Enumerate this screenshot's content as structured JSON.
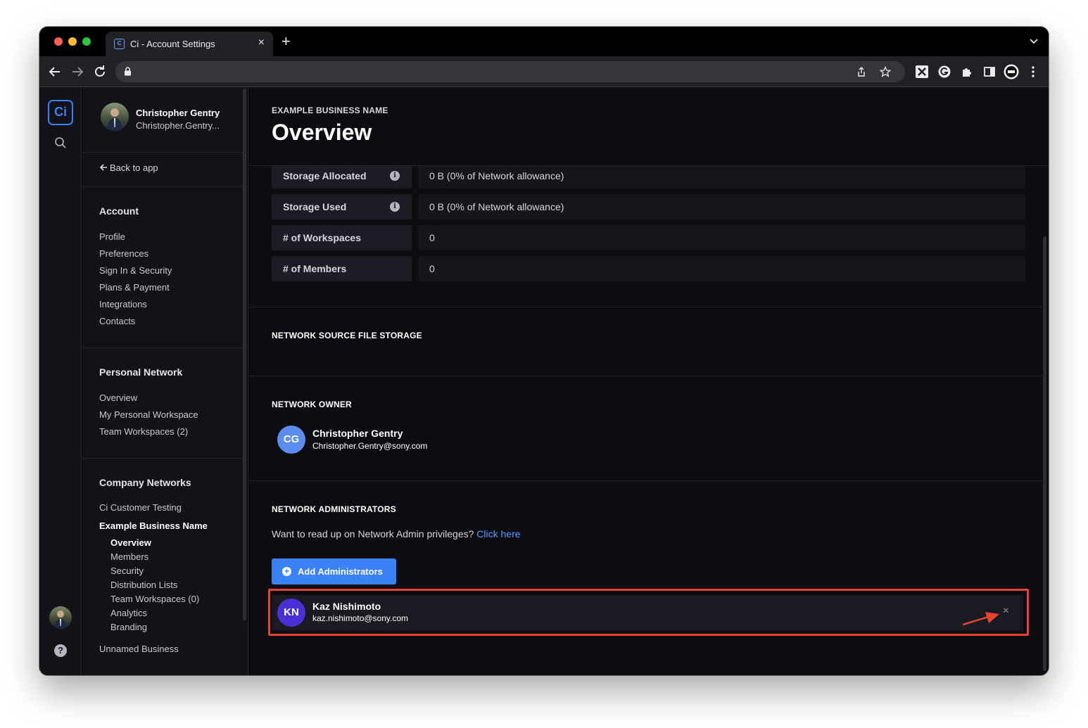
{
  "browser": {
    "tab_title": "Ci - Account Settings",
    "tab_close": "×",
    "new_tab": "+"
  },
  "rail": {
    "logo": "Ci"
  },
  "user": {
    "name": "Christopher Gentry",
    "email": "Christopher.Gentry..."
  },
  "sidebar": {
    "back_label": "Back to app",
    "account_heading": "Account",
    "account_items": [
      "Profile",
      "Preferences",
      "Sign In & Security",
      "Plans & Payment",
      "Integrations",
      "Contacts"
    ],
    "personal_heading": "Personal Network",
    "personal_items": [
      "Overview",
      "My Personal Workspace",
      "Team Workspaces (2)"
    ],
    "company_heading": "Company Networks",
    "company_items": [
      "Ci Customer Testing",
      "Example Business Name"
    ],
    "company_sub_items": [
      "Overview",
      "Members",
      "Security",
      "Distribution Lists",
      "Team Workspaces (0)",
      "Analytics",
      "Branding"
    ],
    "other_network": "Unnamed Business"
  },
  "header": {
    "business_name": "EXAMPLE BUSINESS NAME",
    "title": "Overview"
  },
  "stats": [
    {
      "label": "Storage Allocated",
      "value": "0 B (0% of Network allowance)"
    },
    {
      "label": "Storage Used",
      "value": "0 B (0% of Network allowance)"
    },
    {
      "label": "# of Workspaces",
      "value": "0"
    },
    {
      "label": "# of Members",
      "value": "0"
    }
  ],
  "sections": {
    "source_storage": "NETWORK SOURCE FILE STORAGE",
    "owner": "NETWORK OWNER",
    "admins": "NETWORK ADMINISTRATORS"
  },
  "owner": {
    "initials": "CG",
    "name": "Christopher Gentry",
    "email": "Christopher.Gentry@sony.com",
    "avatar_color": "#5b8def"
  },
  "admins_help": {
    "text": "Want to read up on Network Admin privileges?",
    "link": "Click here"
  },
  "add_admin_label": "Add Administrators",
  "administrators": [
    {
      "initials": "KN",
      "name": "Kaz Nishimoto",
      "email": "kaz.nishimoto@sony.com",
      "avatar_color": "#4b2fd6"
    }
  ],
  "colors": {
    "accent": "#3b82f6",
    "highlight": "#e8432e",
    "link": "#5c9dff"
  }
}
